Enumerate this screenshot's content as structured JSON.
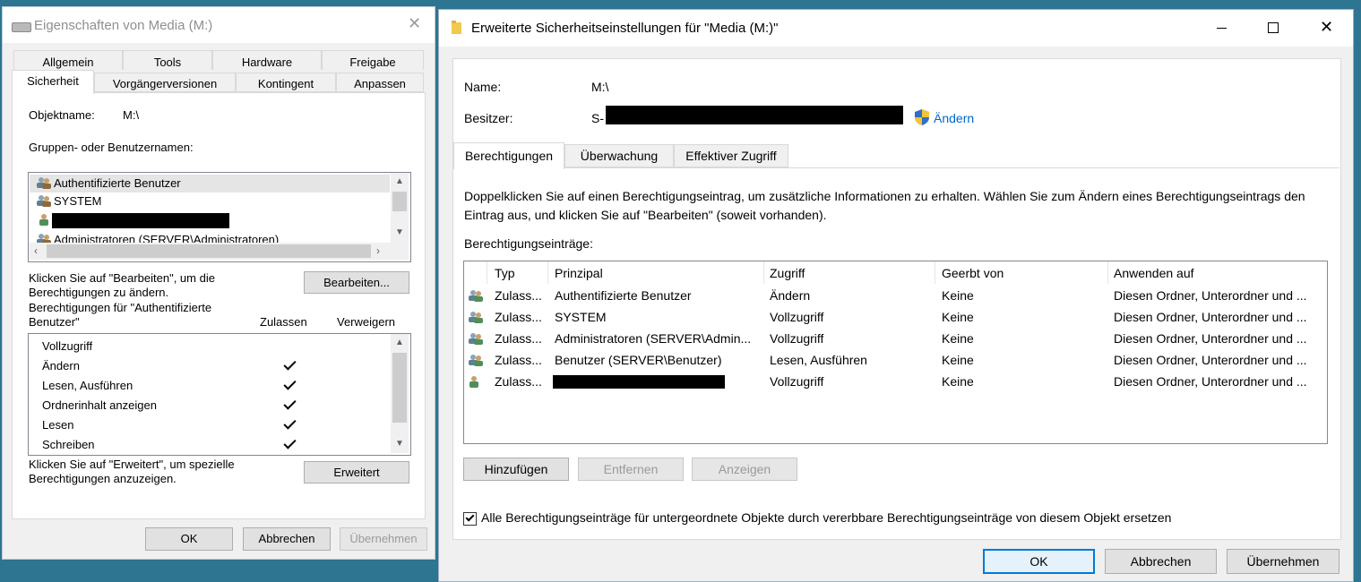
{
  "left": {
    "title": "Eigenschaften von Media (M:)",
    "tabs_row1": [
      "Allgemein",
      "Tools",
      "Hardware",
      "Freigabe"
    ],
    "tabs_row2": [
      "Sicherheit",
      "Vorgängerversionen",
      "Kontingent",
      "Anpassen"
    ],
    "object_label": "Objektname:",
    "object_value": "M:\\",
    "groups_label": "Gruppen- oder Benutzernamen:",
    "groups": [
      "Authentifizierte Benutzer",
      "SYSTEM",
      "",
      "Administratoren (SERVER\\Administratoren)"
    ],
    "edit_hint": "Klicken Sie auf \"Bearbeiten\", um die Berechtigungen zu ändern.",
    "edit_button": "Bearbeiten...",
    "perm_for": "Berechtigungen für \"Authentifizierte Benutzer\"",
    "col_allow": "Zulassen",
    "col_deny": "Verweigern",
    "permissions": [
      {
        "name": "Vollzugriff",
        "allow": false
      },
      {
        "name": "Ändern",
        "allow": true
      },
      {
        "name": "Lesen, Ausführen",
        "allow": true
      },
      {
        "name": "Ordnerinhalt anzeigen",
        "allow": true
      },
      {
        "name": "Lesen",
        "allow": true
      },
      {
        "name": "Schreiben",
        "allow": true
      }
    ],
    "adv_hint": "Klicken Sie auf \"Erweitert\", um spezielle Berechtigungen anzuzeigen.",
    "adv_button": "Erweitert",
    "ok": "OK",
    "cancel": "Abbrechen",
    "apply": "Übernehmen"
  },
  "right": {
    "title": "Erweiterte Sicherheitseinstellungen für \"Media (M:)\"",
    "name_label": "Name:",
    "name_value": "M:\\",
    "owner_label": "Besitzer:",
    "owner_prefix": "S-",
    "change_link": "Ändern",
    "tabs": [
      "Berechtigungen",
      "Überwachung",
      "Effektiver Zugriff"
    ],
    "info": "Doppelklicken Sie auf einen Berechtigungseintrag, um zusätzliche Informationen zu erhalten. Wählen Sie zum Ändern eines Berechtigungseintrags den Eintrag aus, und klicken Sie auf \"Bearbeiten\" (soweit vorhanden).",
    "entries_label": "Berechtigungseinträge:",
    "columns": [
      "Typ",
      "Prinzipal",
      "Zugriff",
      "Geerbt von",
      "Anwenden auf"
    ],
    "rows": [
      {
        "type": "Zulass...",
        "principal": "Authentifizierte Benutzer",
        "access": "Ändern",
        "inherited": "Keine",
        "applies": "Diesen Ordner, Unterordner und ..."
      },
      {
        "type": "Zulass...",
        "principal": "SYSTEM",
        "access": "Vollzugriff",
        "inherited": "Keine",
        "applies": "Diesen Ordner, Unterordner und ..."
      },
      {
        "type": "Zulass...",
        "principal": "Administratoren (SERVER\\Admin...",
        "access": "Vollzugriff",
        "inherited": "Keine",
        "applies": "Diesen Ordner, Unterordner und ..."
      },
      {
        "type": "Zulass...",
        "principal": "Benutzer (SERVER\\Benutzer)",
        "access": "Lesen, Ausführen",
        "inherited": "Keine",
        "applies": "Diesen Ordner, Unterordner und ..."
      },
      {
        "type": "Zulass...",
        "principal": "",
        "access": "Vollzugriff",
        "inherited": "Keine",
        "applies": "Diesen Ordner, Unterordner und ..."
      }
    ],
    "add_button": "Hinzufügen",
    "remove_button": "Entfernen",
    "view_button": "Anzeigen",
    "replace_checkbox": "Alle Berechtigungseinträge für untergeordnete Objekte durch vererbbare Berechtigungseinträge von diesem Objekt ersetzen",
    "replace_checked": true,
    "ok": "OK",
    "cancel": "Abbrechen",
    "apply": "Übernehmen"
  }
}
